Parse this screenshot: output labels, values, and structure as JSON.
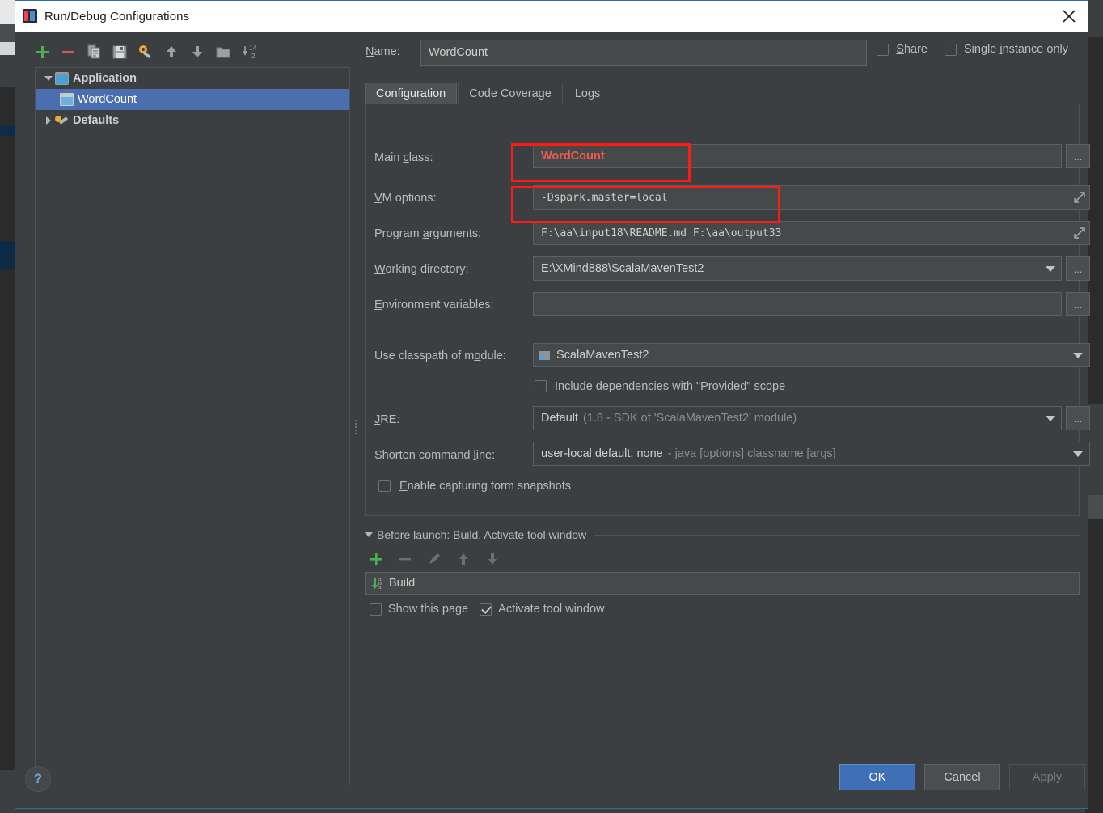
{
  "window": {
    "title": "Run/Debug Configurations",
    "app_icon": "intellij-idea-icon",
    "close_icon": "close-icon"
  },
  "left_toolbar": {
    "buttons": [
      {
        "name": "add-configuration-button",
        "icon": "plus-icon"
      },
      {
        "name": "remove-configuration-button",
        "icon": "minus-icon"
      },
      {
        "name": "copy-configuration-button",
        "icon": "copy-icon"
      },
      {
        "name": "save-configuration-button",
        "icon": "save-icon"
      },
      {
        "name": "edit-templates-button",
        "icon": "wrench-icon"
      },
      {
        "name": "move-up-button",
        "icon": "arrow-up-icon"
      },
      {
        "name": "move-down-button",
        "icon": "arrow-down-icon"
      },
      {
        "name": "new-folder-button",
        "icon": "folder-icon"
      },
      {
        "name": "sort-configurations-button",
        "icon": "sort-az-icon"
      }
    ]
  },
  "tree": {
    "nodes": [
      {
        "label": "Application",
        "type": "group",
        "icon": "application-icon",
        "expanded": true,
        "selected": false
      },
      {
        "label": "WordCount",
        "type": "child",
        "icon": "run-config-icon",
        "expanded": null,
        "selected": true
      },
      {
        "label": "Defaults",
        "type": "group",
        "icon": "defaults-wrench-icon",
        "expanded": false,
        "selected": false
      }
    ]
  },
  "header": {
    "name_label": "Name:",
    "name_value": "WordCount",
    "share_label": "Share",
    "share_checked": false,
    "single_instance_label": "Single instance only",
    "single_instance_checked": false
  },
  "tabs": [
    {
      "label": "Configuration",
      "active": true
    },
    {
      "label": "Code Coverage",
      "active": false
    },
    {
      "label": "Logs",
      "active": false
    }
  ],
  "configuration": {
    "main_class": {
      "label": "Main class:",
      "value": "WordCount",
      "browse": "...",
      "error": true
    },
    "vm_options": {
      "label": "VM options:",
      "value": "-Dspark.master=local",
      "expand_icon": "expand-icon"
    },
    "program_arguments": {
      "label": "Program arguments:",
      "value": "F:\\aa\\input18\\README.md F:\\aa\\output33",
      "expand_icon": "expand-icon"
    },
    "working_directory": {
      "label": "Working directory:",
      "value": "E:\\XMind888\\ScalaMavenTest2",
      "browse": "...",
      "dropdown_icon": "chevron-down-icon"
    },
    "environment_variables": {
      "label": "Environment variables:",
      "value": "",
      "browse": "..."
    },
    "use_classpath_of_module": {
      "label": "Use classpath of module:",
      "value": "ScalaMavenTest2",
      "module_icon": "module-icon",
      "dropdown_icon": "chevron-down-icon"
    },
    "include_provided_scope": {
      "label": "Include dependencies with \"Provided\" scope",
      "checked": false
    },
    "jre": {
      "label": "JRE:",
      "value": "Default",
      "value_hint": "(1.8 - SDK of 'ScalaMavenTest2' module)",
      "browse": "...",
      "dropdown_icon": "chevron-down-icon"
    },
    "shorten_command_line": {
      "label": "Shorten command line:",
      "value": "user-local default: none",
      "value_hint": "- java [options] classname [args]",
      "dropdown_icon": "chevron-down-icon"
    },
    "enable_form_snapshots": {
      "label": "Enable capturing form snapshots",
      "checked": false
    }
  },
  "before_launch": {
    "header": "Before launch: Build, Activate tool window",
    "collapse_icon": "triangle-down-icon",
    "toolbar": [
      {
        "name": "add-task-button",
        "icon": "plus-icon"
      },
      {
        "name": "remove-task-button",
        "icon": "minus-icon"
      },
      {
        "name": "edit-task-button",
        "icon": "pencil-icon"
      },
      {
        "name": "move-task-up-button",
        "icon": "arrow-up-icon"
      },
      {
        "name": "move-task-down-button",
        "icon": "arrow-down-icon"
      }
    ],
    "items": [
      {
        "label": "Build",
        "icon": "build-compile-icon"
      }
    ],
    "show_this_page": {
      "label": "Show this page",
      "checked": false
    },
    "activate_tool_window": {
      "label": "Activate tool window",
      "checked": true
    }
  },
  "footer": {
    "help_label": "?",
    "ok_label": "OK",
    "cancel_label": "Cancel",
    "apply_label": "Apply",
    "apply_enabled": false
  },
  "annotations": [
    {
      "name": "vm-options-highlight",
      "target": "vm_options"
    },
    {
      "name": "program-arguments-highlight",
      "target": "program_arguments"
    }
  ],
  "colors": {
    "accent_blue": "#4b6eaf",
    "error_red": "#f05a4f",
    "annotation_red": "#ff1a14",
    "panel_bg": "#3c3f41",
    "input_bg": "#45494a"
  }
}
